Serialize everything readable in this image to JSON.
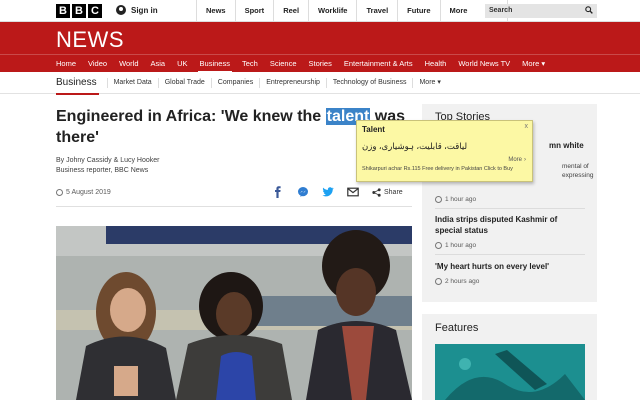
{
  "topbar": {
    "logo_letters": [
      "B",
      "B",
      "C"
    ],
    "signin_label": "Sign in",
    "nav": [
      "News",
      "Sport",
      "Reel",
      "Worklife",
      "Travel",
      "Future",
      "More"
    ],
    "search_placeholder": "Search"
  },
  "news_bar": {
    "title": "NEWS",
    "sections": [
      "Home",
      "Video",
      "World",
      "Asia",
      "UK",
      "Business",
      "Tech",
      "Science",
      "Stories",
      "Entertainment & Arts",
      "Health",
      "World News TV",
      "More ▾"
    ],
    "active_section": "Business"
  },
  "subnav": {
    "current": "Business",
    "items": [
      "Market Data",
      "Global Trade",
      "Companies",
      "Entrepreneurship",
      "Technology of Business",
      "More ▾"
    ]
  },
  "article": {
    "headline_before": "Engineered in Africa: 'We knew the ",
    "headline_highlight": "talent",
    "headline_after": " was there'",
    "byline_authors": "By Johny Cassidy & Lucy Hooker",
    "byline_role": "Business reporter, BBC News",
    "date": "5 August 2019",
    "share_label": "Share"
  },
  "top_stories": {
    "heading": "Top Stories",
    "fragment_headline": "mn white",
    "fragment_summary": "mental of expressing",
    "items": [
      {
        "title": "",
        "time": "1 hour ago"
      },
      {
        "title": "India strips disputed Kashmir of special status",
        "time": "1 hour ago"
      },
      {
        "title": "'My heart hurts on every level'",
        "time": "2 hours ago"
      }
    ]
  },
  "features": {
    "heading": "Features"
  },
  "dictionary_popup": {
    "word": "Talent",
    "close_label": "x",
    "translation": "لیاقت، قابلیت، ہوشیاری، وزن",
    "more_label": "More",
    "ad_text": "Shikarpuri achar Rs.115 Free delivery in Pakistan Click to Buy"
  },
  "colors": {
    "brand_red": "#bb1919",
    "highlight_blue": "#3b83c8",
    "popup_yellow": "#fcf8a4",
    "panel_grey": "#f1f1f1"
  }
}
